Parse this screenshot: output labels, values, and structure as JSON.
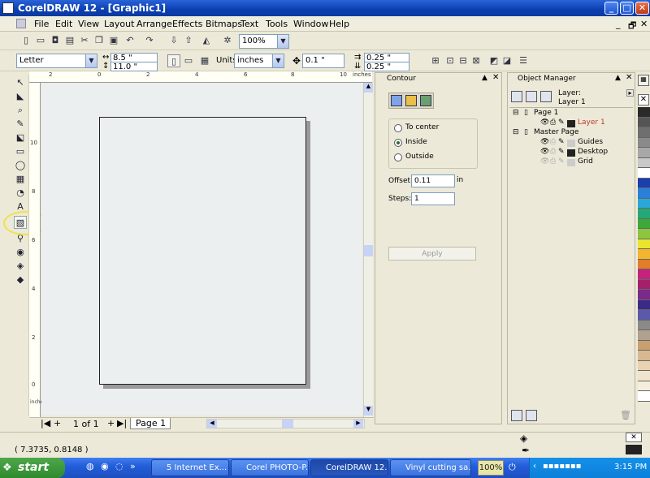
{
  "window": {
    "title": "CorelDRAW 12 - [Graphic1]",
    "min_glyph": "_",
    "max_glyph": "□",
    "close_glyph": "✕",
    "doc_min_glyph": "_",
    "doc_restore_glyph": "🗗",
    "doc_close_glyph": "✕"
  },
  "menu": {
    "items": [
      "File",
      "Edit",
      "View",
      "Layout",
      "Arrange",
      "Effects",
      "Bitmaps",
      "Text",
      "Tools",
      "Window",
      "Help"
    ]
  },
  "standard_toolbar": {
    "zoom_value": "100%"
  },
  "property_bar": {
    "paper_size": "Letter",
    "width": "8.5 \"",
    "height": "11.0 \"",
    "units_label": "Units:",
    "units_value": "inches",
    "nudge": "0.1 \"",
    "dup_x": "0.25 \"",
    "dup_y": "0.25 \""
  },
  "rulers": {
    "unit_label": "inches",
    "h_ticks": [
      "2",
      "0",
      "2",
      "4",
      "6",
      "8",
      "10"
    ],
    "v_ticks": [
      "10",
      "8",
      "6",
      "4",
      "2",
      "0"
    ],
    "v_unit": "inches"
  },
  "page_nav": {
    "page_count": "1 of 1",
    "page_tab": "Page 1",
    "first_glyph": "|◀",
    "prev_glyph": "◀",
    "add_glyph": "+",
    "next_glyph": "▶",
    "last_glyph": "▶|"
  },
  "contour": {
    "title": "Contour",
    "options": [
      "To center",
      "Inside",
      "Outside"
    ],
    "selected": "Inside",
    "offset_label": "Offset:",
    "offset_value": "0.11",
    "offset_unit": "in",
    "steps_label": "Steps:",
    "steps_value": "1",
    "apply_label": "Apply"
  },
  "object_manager": {
    "title": "Object Manager",
    "layer_label": "Layer:",
    "layer_value": "Layer 1",
    "page1": "Page 1",
    "layer1": "Layer 1",
    "master_page": "Master Page",
    "guides": "Guides",
    "desktop": "Desktop",
    "grid": "Grid",
    "layer1_color": "#c0392b"
  },
  "palette": {
    "colors": [
      "#2a2a2a",
      "#555555",
      "#6f6f6f",
      "#8a8a8a",
      "#a8a8a8",
      "#c8c8c8",
      "#ffffff",
      "#1a3fae",
      "#2b7fd6",
      "#2aa7d9",
      "#25a878",
      "#3da93a",
      "#8cc63e",
      "#e8e62e",
      "#f2b52f",
      "#e27d2a",
      "#c5227c",
      "#a4206b",
      "#7a2a8a",
      "#3b2a87",
      "#5a5aa8",
      "#8a8a8a",
      "#b0a090",
      "#c8a070",
      "#d8b890",
      "#e9d2b2",
      "#f0e4cc",
      "#f5eedc",
      "#ffffff"
    ]
  },
  "status": {
    "coords": "( 7.3735, 0.8148 )"
  },
  "taskbar": {
    "start_label": "start",
    "tasks": [
      "5 Internet Ex...",
      "Corel PHOTO-P...",
      "CorelDRAW 12...",
      "Vinyl cutting sa..."
    ],
    "tray_zoom": "100%",
    "clock": "3:15 PM"
  }
}
